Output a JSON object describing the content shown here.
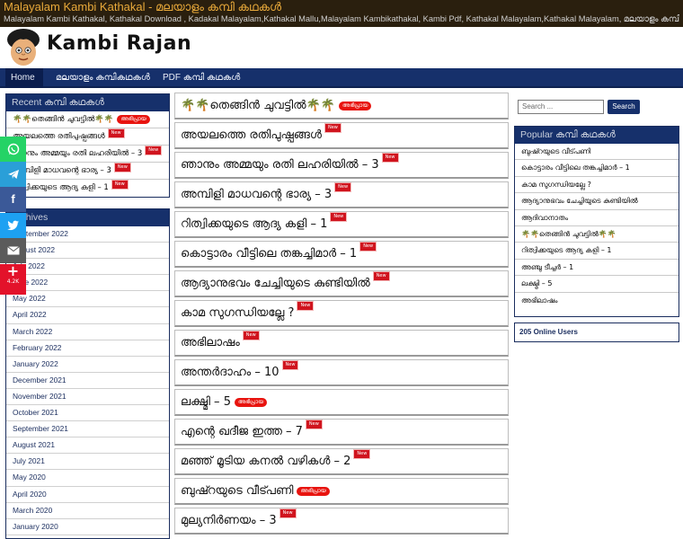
{
  "topbar": {
    "title": "Malayalam Kambi Kathakal - മലയാളം കമ്പി കഥകൾ",
    "tagline": "Malayalam Kambi Kathakal, Kathakal Download , Kadakal Malayalam,Kathakal Mallu,Malayalam Kambikathakal, Kambi Pdf, Kathakal Malayalam,Kathakal Malayalam, മലയാളം കമ്പി കഥകൾ"
  },
  "brand": {
    "name": "Kambi Rajan"
  },
  "nav": {
    "items": [
      "Home",
      "മലയാളം കമ്പികഥകൾ",
      "PDF കമ്പി കഥകൾ"
    ]
  },
  "recent": {
    "heading": "Recent കമ്പി കഥകൾ",
    "items": [
      {
        "label": "🌴🌴തെങ്ങിൻ ചുവട്ടിൽ🌴🌴",
        "badge": "അഭിപ്രായ"
      },
      {
        "label": "അയലത്തെ രതിപുഷ്പങ്ങൾ",
        "badge": "New"
      },
      {
        "label": "ഞാനും അമ്മയും രതി ലഹരിയിൽ – 3",
        "badge": "New"
      },
      {
        "label": "അമ്പിളി മാധവന്റെ ഭാര്യ – 3",
        "badge": "New"
      },
      {
        "label": "റിത്വിക്കയുടെ ആദ്യ കളി – 1",
        "badge": "New"
      }
    ]
  },
  "archives": {
    "heading": "Archives",
    "items": [
      "September 2022",
      "August 2022",
      "July 2022",
      "June 2022",
      "May 2022",
      "April 2022",
      "March 2022",
      "February 2022",
      "January 2022",
      "December 2021",
      "November 2021",
      "October 2021",
      "September 2021",
      "August 2021",
      "July 2021",
      "May 2020",
      "April 2020",
      "March 2020",
      "January 2020"
    ]
  },
  "share": {
    "count": "4.2K"
  },
  "posts": [
    {
      "title": "🌴🌴തെങ്ങിൻ ചുവട്ടിൽ🌴🌴",
      "badge": "അഭിപ്രായ",
      "badge_type": "ml"
    },
    {
      "title": "അയലത്തെ രതിപുഷ്പങ്ങൾ",
      "badge": "New",
      "badge_type": "new"
    },
    {
      "title": "ഞാനും അമ്മയും രതി ലഹരിയിൽ – 3",
      "badge": "New",
      "badge_type": "new"
    },
    {
      "title": "അമ്പിളി മാധവന്റെ ഭാര്യ – 3",
      "badge": "New",
      "badge_type": "new"
    },
    {
      "title": "റിത്വിക്കയുടെ ആദ്യ കളി – 1",
      "badge": "New",
      "badge_type": "new"
    },
    {
      "title": "കൊട്ടാരം വീട്ടിലെ തങ്കച്ചിമാർ – 1",
      "badge": "New",
      "badge_type": "new"
    },
    {
      "title": "ആദ്യാനുഭവം ചേച്ചിയുടെ കുണ്ടിയിൽ",
      "badge": "New",
      "badge_type": "new"
    },
    {
      "title": "കാമ സുഗന്ധിയല്ലേ ?",
      "badge": "New",
      "badge_type": "new"
    },
    {
      "title": "അഭിലാഷം",
      "badge": "New",
      "badge_type": "new"
    },
    {
      "title": "അന്തർദാഹം – 10",
      "badge": "New",
      "badge_type": "new"
    },
    {
      "title": "ലക്ഷ്മി – 5",
      "badge": "അഭിപ്രായ",
      "badge_type": "ml"
    },
    {
      "title": "എന്റെ ഖദീജ ഇത്ത – 7",
      "badge": "New",
      "badge_type": "new"
    },
    {
      "title": "മഞ്ഞ് മൂടിയ കനൽ വഴികൾ – 2",
      "badge": "New",
      "badge_type": "new"
    },
    {
      "title": "ബുഷ്റയുടെ വീട്പണി",
      "badge": "അഭിപ്രായ",
      "badge_type": "ml"
    },
    {
      "title": "മുല്യനിർണയം – 3",
      "badge": "New",
      "badge_type": "new"
    }
  ],
  "search": {
    "placeholder": "Search ...",
    "button": "Search"
  },
  "popular": {
    "heading": "Popular കമ്പി കഥകൾ",
    "items": [
      "ബുഷ്റയുടെ വീട്പണി",
      "കൊട്ടാരം വീട്ടിലെ തങ്കച്ചിമാർ – 1",
      "കാമ സുഗന്ധിയല്ലേ ?",
      "ആദ്യാനുഭവം ചേച്ചിയുടെ കുണ്ടിയിൽ",
      "ആദിവാനാതം",
      "🌴🌴തെങ്ങിൻ ചുവട്ടിൽ🌴🌴",
      "റിത്വിക്കയുടെ ആദ്യ കളി – 1",
      "അഞ്ചു ടീച്ചർ – 1",
      "ലക്ഷ്മി – 5",
      "അഭിലാഷം"
    ]
  },
  "online": {
    "text": "205 Online Users"
  },
  "colors": {
    "nav": "#16306b",
    "topbar": "#2a1f0e",
    "title_accent": "#e8a93a",
    "new_badge": "#d0141e"
  }
}
